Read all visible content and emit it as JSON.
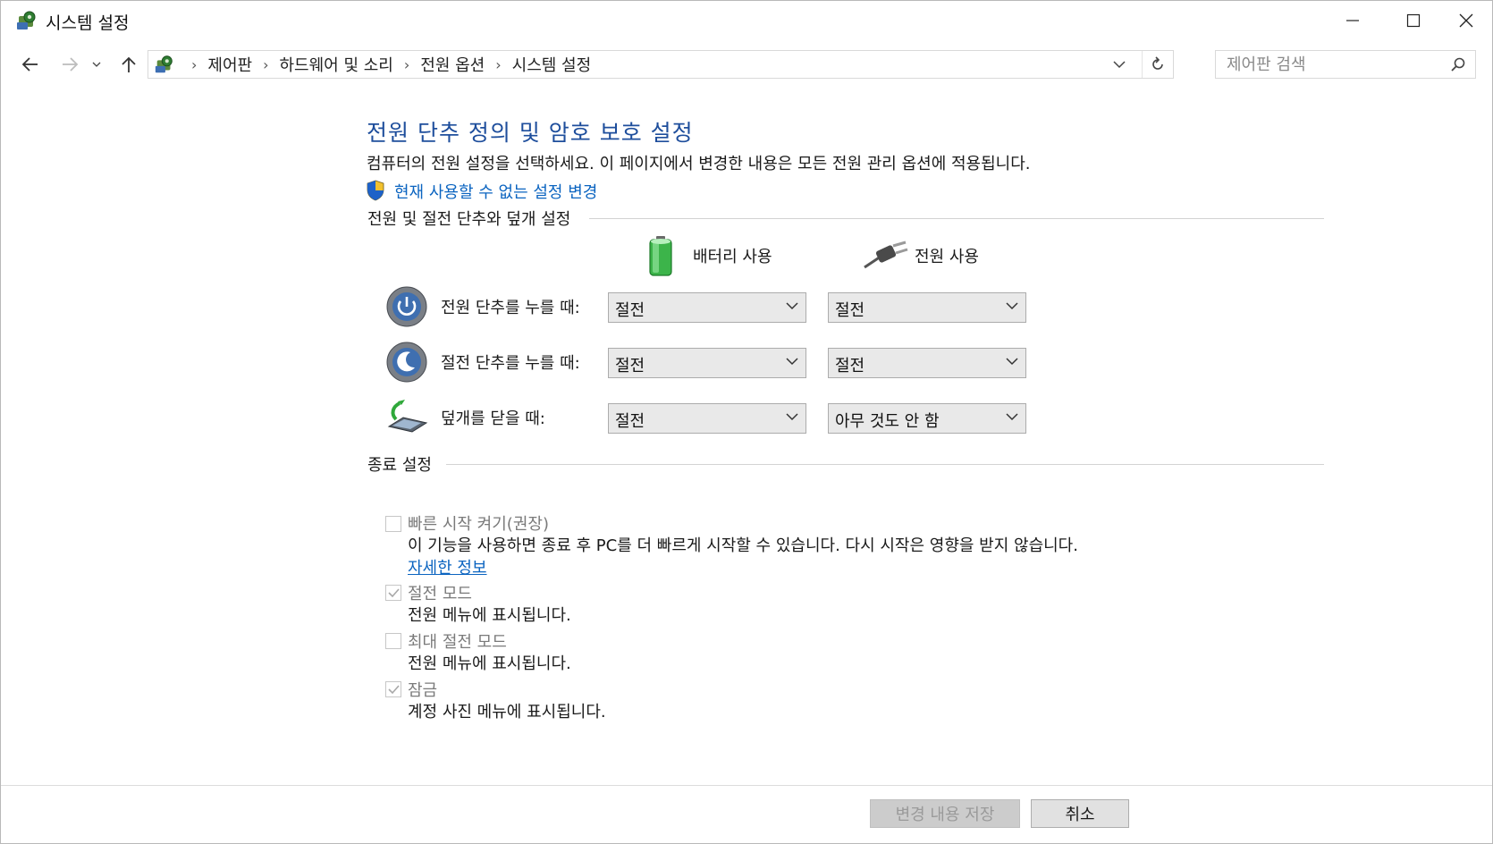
{
  "window": {
    "title": "시스템 설정"
  },
  "nav": {
    "breadcrumbs": [
      "제어판",
      "하드웨어 및 소리",
      "전원 옵션",
      "시스템 설정"
    ],
    "search_placeholder": "제어판 검색"
  },
  "main": {
    "heading": "전원 단추 정의 및 암호 보호 설정",
    "description": "컴퓨터의 전원 설정을 선택하세요. 이 페이지에서 변경한 내용은 모든 전원 관리 옵션에 적용됩니다.",
    "admin_link": "현재 사용할 수 없는 설정 변경",
    "power_section_title": "전원 및 절전 단추와 덮개 설정",
    "columns": {
      "battery": "배터리 사용",
      "plugged": "전원 사용"
    },
    "rows": [
      {
        "label": "전원 단추를 누를 때:",
        "battery": "절전",
        "plugged": "절전"
      },
      {
        "label": "절전 단추를 누를 때:",
        "battery": "절전",
        "plugged": "절전"
      },
      {
        "label": "덮개를 닫을 때:",
        "battery": "절전",
        "plugged": "아무 것도 안 함"
      }
    ],
    "shutdown_section_title": "종료 설정",
    "shutdown_options": [
      {
        "label": "빠른 시작 켜기(권장)",
        "description": "이 기능을 사용하면 종료 후 PC를 더 빠르게 시작할 수 있습니다. 다시 시작은 영향을 받지 않습니다.",
        "checked": false
      },
      {
        "label": "절전 모드",
        "description": "전원 메뉴에 표시됩니다.",
        "checked": true
      },
      {
        "label": "최대 절전 모드",
        "description": "전원 메뉴에 표시됩니다.",
        "checked": false
      },
      {
        "label": "잠금",
        "description": "계정 사진 메뉴에 표시됩니다.",
        "checked": true
      }
    ],
    "more_info_link": "자세한 정보"
  },
  "footer": {
    "save_label": "변경 내용 저장",
    "cancel_label": "취소"
  },
  "colors": {
    "heading": "#1e4e9c",
    "link": "#0b64c0",
    "battery_green": "#3cb44a"
  },
  "icons": [
    "control-panel-icon",
    "back-arrow-icon",
    "forward-arrow-icon",
    "recent-dropdown-icon",
    "up-arrow-icon",
    "refresh-icon",
    "search-icon",
    "uac-shield-icon",
    "battery-icon",
    "plug-icon",
    "power-button-icon",
    "sleep-button-icon",
    "laptop-lid-icon"
  ]
}
